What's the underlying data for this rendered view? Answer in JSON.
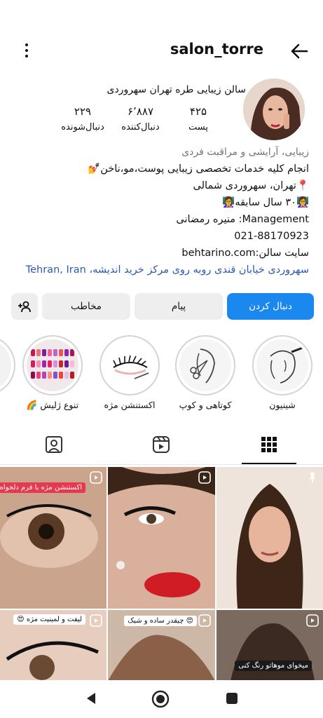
{
  "header": {
    "username": "salon_torre",
    "icons": {
      "back": "arrow-left-icon",
      "menu": "more-vertical-icon"
    }
  },
  "profile": {
    "full_name": "سالن زیبایی طره تهران سهروردی",
    "stats": [
      {
        "value": "۴۲۵",
        "label": "پست"
      },
      {
        "value": "۶٬۸۸۷",
        "label": "دنبال‌کننده"
      },
      {
        "value": "۲۲۹",
        "label": "دنبال‌شونده"
      }
    ]
  },
  "bio": {
    "category": "زیبایی، آرایشی و مراقبت فردی",
    "line1": "انجام کلیه خدمات تخصصی زیبایی پوست،مو،ناخن💅",
    "line2": "📍تهران، سهروردی شمالی",
    "line3": "👩‍🏫۳۰ سال سابقه👩‍🏫",
    "line4": "Management: منیره رمضانی",
    "line5": "021-88170923",
    "line6": "سایت سالن:behtarino.com",
    "address": "سهروردی خیابان قندی روبه روی مرکز خرید اندیشه، Tehran, Iran"
  },
  "actions": {
    "follow": "دنبال کردن",
    "message": "پیام",
    "contact": "مخاطب",
    "add_user_icon": "add-person-icon"
  },
  "highlights": [
    {
      "label": "شینیون"
    },
    {
      "label": "کوتاهی و کوپ"
    },
    {
      "label": "اکستنشن مژه"
    },
    {
      "label": "تنوع ژلیش 🌈"
    }
  ],
  "tabs": [
    {
      "name": "grid",
      "icon": "grid-icon",
      "active": true
    },
    {
      "name": "reels",
      "icon": "reels-icon",
      "active": false
    },
    {
      "name": "tagged",
      "icon": "tagged-user-icon",
      "active": false
    }
  ],
  "posts": [
    {
      "caption": "اکستنشن مژه با فرم دلخواه شما 😍",
      "type": "reel"
    },
    {
      "caption": "",
      "type": "reel"
    },
    {
      "caption": "",
      "type": "pinned"
    },
    {
      "caption": "لیفت و لمینیت مژه 😍",
      "type": "reel"
    },
    {
      "caption": "😍 چیقدر ساده و شیک",
      "type": "reel"
    },
    {
      "caption": "میخوای موهاتو رنگ کنی",
      "type": "reel"
    }
  ],
  "colors": {
    "accent": "#1b88f0",
    "link": "#2b5bb3",
    "secondary_btn": "#eeeeee"
  }
}
